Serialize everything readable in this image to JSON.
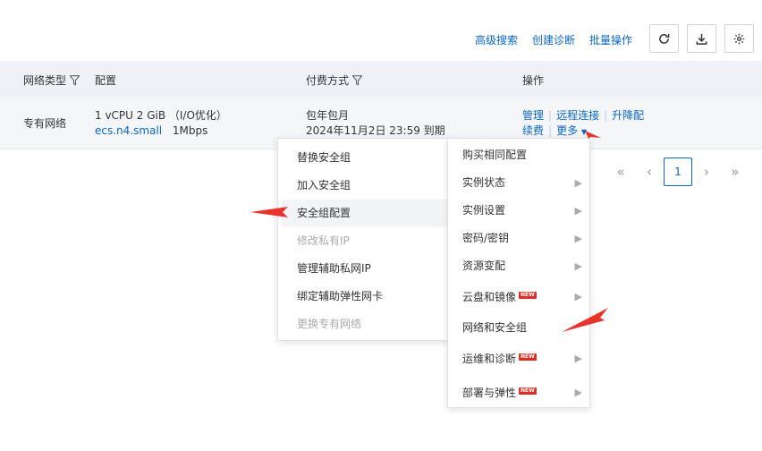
{
  "toolbar": {
    "advanced_search": "高级搜索",
    "create_diagnosis": "创建诊断",
    "batch_operation": "批量操作"
  },
  "table": {
    "headers": {
      "network_type": "网络类型",
      "config": "配置",
      "billing": "付费方式",
      "actions": "操作"
    },
    "row": {
      "network_type": "专有网络",
      "config_line1": "1 vCPU 2 GiB （I/O优化）",
      "instance_type": "ecs.n4.small",
      "bandwidth": "1Mbps",
      "billing_line1": "包年包月",
      "billing_line2": "2024年11月2日 23:59 到期",
      "actions": {
        "manage": "管理",
        "remote_connect": "远程连接",
        "upgrade": "升降配",
        "renew": "续费",
        "more": "更多"
      }
    }
  },
  "pagination": {
    "current_page": "1"
  },
  "security_group_menu": [
    "替换安全组",
    "加入安全组",
    "安全组配置",
    "修改私有IP",
    "管理辅助私网IP",
    "绑定辅助弹性网卡",
    "更换专有网络"
  ],
  "more_menu": [
    "购买相同配置",
    "实例状态",
    "实例设置",
    "密码/密钥",
    "资源变配",
    "云盘和镜像",
    "网络和安全组",
    "运维和诊断",
    "部署与弹性"
  ],
  "badge_new": "NEW",
  "colors": {
    "link": "#0a66c2",
    "annotation_arrow": "#e8322c",
    "badge": "#d93026"
  }
}
